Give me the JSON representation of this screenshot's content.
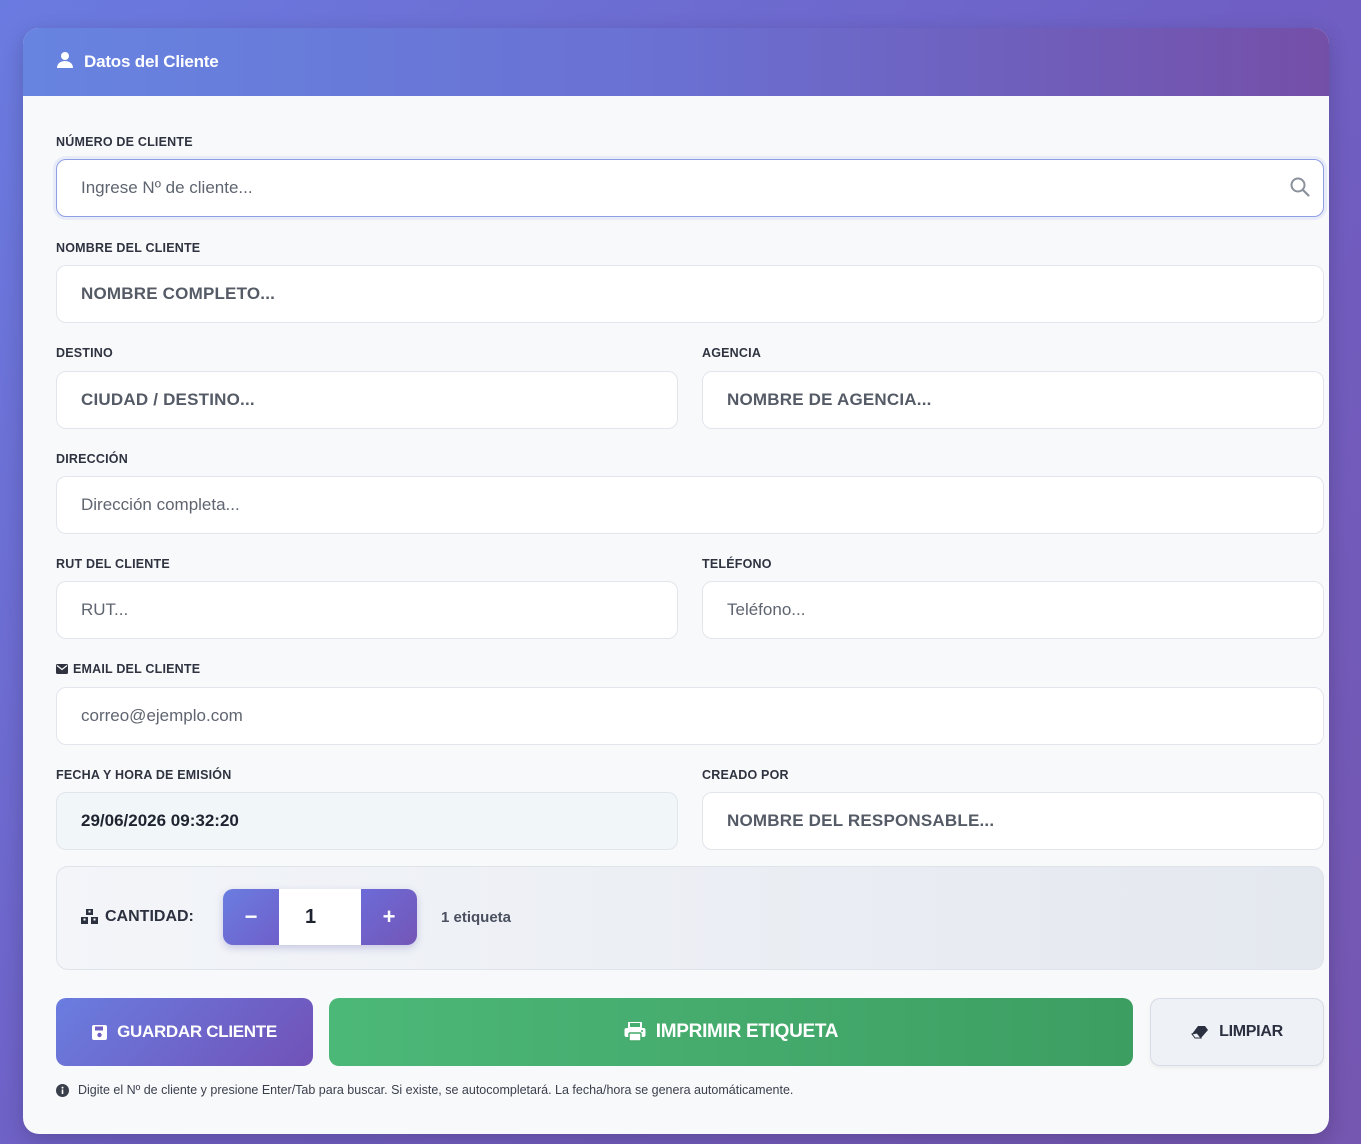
{
  "header": {
    "title": "Datos del Cliente",
    "icon": "user-icon"
  },
  "fields": {
    "numero": {
      "label": "NÚMERO DE CLIENTE",
      "placeholder": "Ingrese Nº de cliente..."
    },
    "nombre": {
      "label": "NOMBRE DEL CLIENTE",
      "placeholder": "NOMBRE COMPLETO..."
    },
    "destino": {
      "label": "DESTINO",
      "placeholder": "CIUDAD / DESTINO..."
    },
    "agencia": {
      "label": "AGENCIA",
      "placeholder": "NOMBRE DE AGENCIA..."
    },
    "direccion": {
      "label": "DIRECCIÓN",
      "placeholder": "Dirección completa..."
    },
    "rut": {
      "label": "RUT DEL CLIENTE",
      "placeholder": "RUT..."
    },
    "telefono": {
      "label": "TELÉFONO",
      "placeholder": "Teléfono..."
    },
    "email": {
      "label": "EMAIL DEL CLIENTE",
      "placeholder": "correo@ejemplo.com"
    },
    "fecha": {
      "label": "FECHA Y HORA DE EMISIÓN",
      "value": "29/06/2026 09:32:20"
    },
    "creado": {
      "label": "CREADO POR",
      "placeholder": "NOMBRE DEL RESPONSABLE..."
    }
  },
  "quantity": {
    "label": "CANTIDAD:",
    "minus": "−",
    "value": "1",
    "plus": "+",
    "note": "1 etiqueta"
  },
  "buttons": {
    "save": "GUARDAR CLIENTE",
    "print": "IMPRIMIR ETIQUETA",
    "clear": "LIMPIAR"
  },
  "hint": "Digite el Nº de cliente y presione Enter/Tab para buscar. Si existe, se autocompletará. La fecha/hora se genera automáticamente.",
  "colors": {
    "accent": "#6a7be0",
    "accent_dark": "#7152b8",
    "success": "#45ab6d"
  }
}
